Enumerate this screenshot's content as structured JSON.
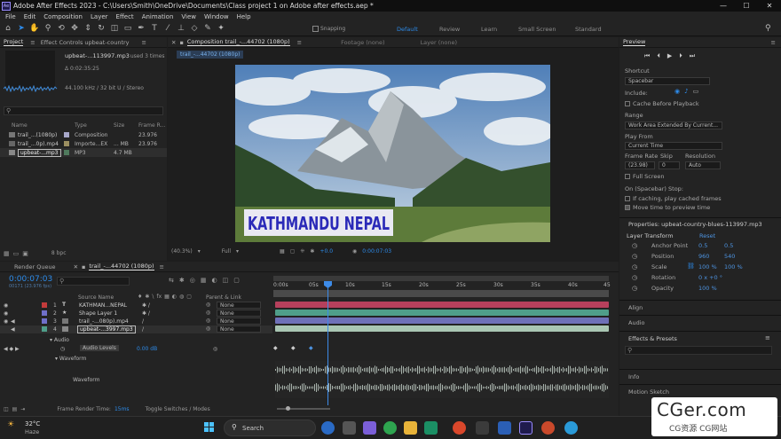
{
  "window": {
    "title": "Adobe After Effects 2023 - C:\\Users\\Smith\\OneDrive\\Documents\\Class project 1 on Adobe after effects.aep *",
    "logo": "Ae",
    "controls": [
      "—",
      "☐",
      "✕"
    ]
  },
  "menu": [
    "File",
    "Edit",
    "Composition",
    "Layer",
    "Effect",
    "Animation",
    "View",
    "Window",
    "Help"
  ],
  "toolbar": {
    "snapping": "Snapping",
    "workspaces": [
      "Default",
      "Review",
      "Learn",
      "Small Screen",
      "Standard"
    ],
    "active_workspace": "Default"
  },
  "project": {
    "tab": "Project",
    "effects_tab": "Effect Controls upbeat-country",
    "item_name": "upbeat-...113997.mp3",
    "used": ", used 3 times",
    "duration": "Δ 0:02:35:25",
    "audio_info": "44.100 kHz / 32 bit U / Stereo",
    "search_icon": "search-icon",
    "columns": [
      "Name",
      "Type",
      "Size",
      "Frame R..."
    ],
    "items": [
      {
        "name": "trail_...(1080p)",
        "type": "Composition",
        "size": "",
        "fps": "23.976",
        "color": "#a7a7c9"
      },
      {
        "name": "trail_...0p).mp4",
        "type": "Importe...EX",
        "size": "... MB",
        "fps": "23.976",
        "color": "#9c8f61"
      },
      {
        "name": "upbeat-...mp3",
        "type": "MP3",
        "size": "4.7 MB",
        "fps": "",
        "color": "#4f7a5d"
      }
    ],
    "bpc": "8 bpc"
  },
  "composition": {
    "tab": "Composition trail_-...44702 (1080p)",
    "footage_tab": "Footage (none)",
    "layer_tab": "Layer (none)",
    "crumb": "trail_-...44702 (1080p)",
    "title_text": "KATHMANDU NEPAL",
    "zoom": "(40.3%)",
    "resolution": "Full",
    "exposure": "+0.0",
    "timecode": "0:00:07:03"
  },
  "preview": {
    "title": "Preview",
    "shortcut_label": "Shortcut",
    "shortcut": "Spacebar",
    "include_label": "Include:",
    "cache": "Cache Before Playback",
    "range_label": "Range",
    "range": "Work Area Extended By Current...",
    "playfrom_label": "Play From",
    "playfrom": "Current Time",
    "fr_label": "Frame Rate",
    "skip_label": "Skip",
    "res_label": "Resolution",
    "fr": "(23.98)",
    "skip": "0",
    "res": "Auto",
    "fullscreen": "Full Screen",
    "stop_label": "On (Spacebar) Stop:",
    "stop1": "If caching, play cached frames",
    "stop2": "Move time to preview time"
  },
  "properties": {
    "title": "Properties: upbeat-country-blues-113997.mp3",
    "section": "Layer Transform",
    "reset": "Reset",
    "rows": [
      {
        "label": "Anchor Point",
        "v1": "0.5",
        "v2": "0.5"
      },
      {
        "label": "Position",
        "v1": "960",
        "v2": "540"
      },
      {
        "label": "Scale",
        "v1": "100 %",
        "v2": "100 %"
      },
      {
        "label": "Rotation",
        "v1": "0 x +0 °",
        "v2": ""
      },
      {
        "label": "Opacity",
        "v1": "100 %",
        "v2": ""
      }
    ],
    "align": "Align",
    "audio": "Audio",
    "effects": "Effects & Presets",
    "info": "Info",
    "motion": "Motion Sketch"
  },
  "timeline": {
    "render_queue": "Render Queue",
    "comp_tab": "trail_-...44702 (1080p)",
    "timecode": "0:00:07:03",
    "frames": "00171 (23.976 fps)",
    "col_source": "Source Name",
    "col_parent": "Parent & Link",
    "layers": [
      {
        "num": "1",
        "name": "KATHMAN...NEPAL",
        "parent": "None",
        "label_color": "#c33b3b",
        "bar_color": "#b6405c",
        "icon": "text-layer-icon"
      },
      {
        "num": "2",
        "name": "Shape Layer 1",
        "parent": "None",
        "label_color": "#6f6fc9",
        "bar_color": "#4f9e8a",
        "icon": "shape-layer-icon"
      },
      {
        "num": "3",
        "name": "trail_-...080p).mp4",
        "parent": "None",
        "label_color": "#6f6fc9",
        "bar_color": "#6e70b8",
        "icon": "footage-icon"
      },
      {
        "num": "4",
        "name": "upbeat-...3997.mp3",
        "parent": "None",
        "label_color": "#4f9e8a",
        "bar_color": "#a9c6b3",
        "icon": "audio-layer-icon"
      }
    ],
    "audio_group": "Audio",
    "audio_levels": "Audio Levels",
    "audio_value": "0.00 dB",
    "waveform_group": "Waveform",
    "waveform_label": "Waveform",
    "ruler": [
      "0:00s",
      "05s",
      "10s",
      "15s",
      "20s",
      "25s",
      "30s",
      "35s",
      "40s",
      "45"
    ],
    "render_time_label": "Frame Render Time:",
    "render_time": "15ms",
    "toggle": "Toggle Switches / Modes"
  },
  "taskbar": {
    "temp": "32°C",
    "weather": "Haze",
    "search": "Search"
  },
  "watermark": {
    "big": "CGer.com",
    "small": "CG资源 CG网站"
  }
}
